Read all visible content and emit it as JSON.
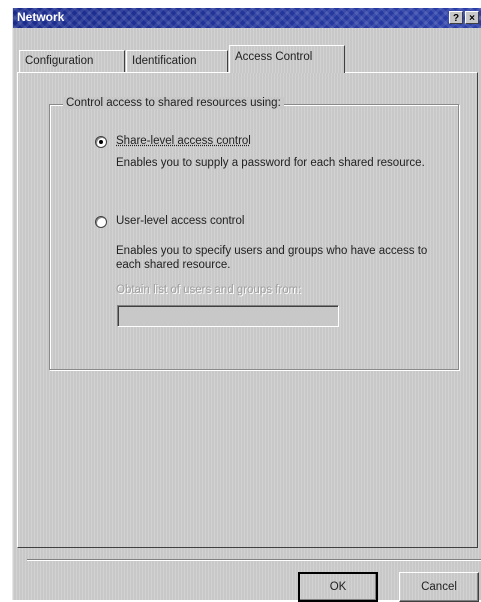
{
  "window": {
    "title": "Network",
    "help_button": "?",
    "close_button": "×"
  },
  "tabs": [
    {
      "label": "Configuration",
      "selected": false
    },
    {
      "label": "Identification",
      "selected": false
    },
    {
      "label": "Access Control",
      "selected": true
    }
  ],
  "access_group": {
    "legend": "Control access to shared resources using:",
    "options": [
      {
        "label": "Share-level access control",
        "description": "Enables you to supply a password for each shared resource.",
        "selected": true
      },
      {
        "label": "User-level access control",
        "description": "Enables you to specify users and groups who have access to each shared resource.",
        "selected": false
      }
    ],
    "obtain_label": "Obtain list of users and groups from:",
    "obtain_value": ""
  },
  "buttons": {
    "ok": "OK",
    "cancel": "Cancel"
  },
  "colors": {
    "titlebar": "#1a2b8c",
    "face": "#c8c8c8"
  }
}
